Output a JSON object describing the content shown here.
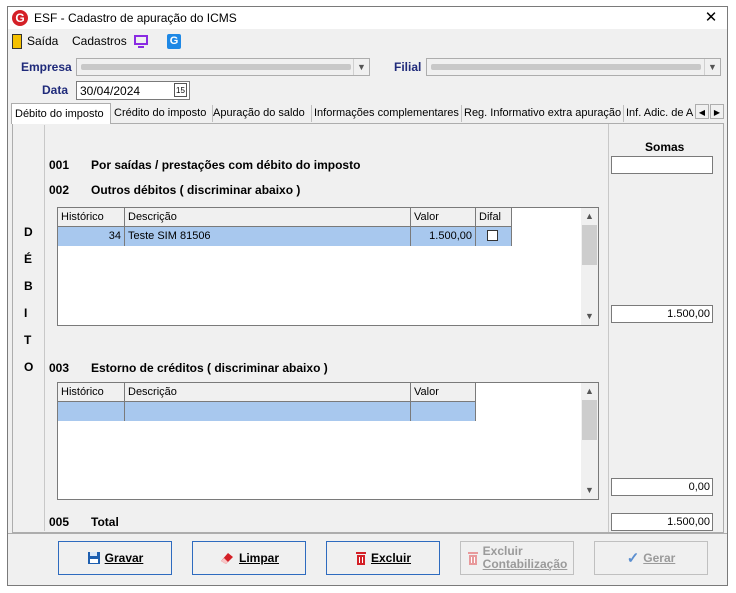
{
  "window": {
    "title": "ESF - Cadastro de apuração do ICMS",
    "close_glyph": "✕",
    "logo_letter": "G"
  },
  "menu": {
    "saida": "Saída",
    "cadastros": "Cadastros",
    "icons": [
      "exit-icon",
      "monitor-icon",
      "g-app-icon"
    ]
  },
  "form": {
    "empresa_label": "Empresa",
    "filial_label": "Filial",
    "data_label": "Data",
    "data_value": "30/04/2024",
    "calendar_glyph": "15"
  },
  "tabs": [
    {
      "label": "Débito do imposto",
      "active": true
    },
    {
      "label": "Crédito do imposto"
    },
    {
      "label": "Apuração do saldo"
    },
    {
      "label": "Informações complementares"
    },
    {
      "label": "Reg. Informativo extra apuração"
    },
    {
      "label": "Inf. Adic. de A"
    }
  ],
  "side_letters": [
    "D",
    "É",
    "B",
    "I",
    "T",
    "O"
  ],
  "sections": {
    "s001_num": "001",
    "s001_text": "Por saídas / prestações com débito do imposto",
    "s002_num": "002",
    "s002_text": "Outros débitos ( discriminar abaixo )",
    "s003_num": "003",
    "s003_text": "Estorno de créditos ( discriminar abaixo )",
    "s005_num": "005",
    "s005_text": "Total"
  },
  "grid_debitos": {
    "headers": [
      "Histórico",
      "Descrição",
      "Valor",
      "Difal"
    ],
    "rows": [
      {
        "historico": "34",
        "descricao": "Teste SIM 81506",
        "valor": "1.500,00",
        "difal": false
      }
    ]
  },
  "grid_estornos": {
    "headers": [
      "Histórico",
      "Descrição",
      "Valor"
    ],
    "rows": []
  },
  "somas": {
    "title": "Somas",
    "s001": "",
    "s002": "1.500,00",
    "s003": "0,00",
    "s005": "1.500,00"
  },
  "buttons": {
    "gravar": "Gravar",
    "limpar": "Limpar",
    "excluir": "Excluir",
    "excluir_contab_1": "Excluir",
    "excluir_contab_2": "Contabilização",
    "gerar": "Gerar"
  },
  "colors": {
    "selected_row": "#a8c8ee",
    "label_blue": "#1f2a7a",
    "danger_red": "#d42027"
  }
}
